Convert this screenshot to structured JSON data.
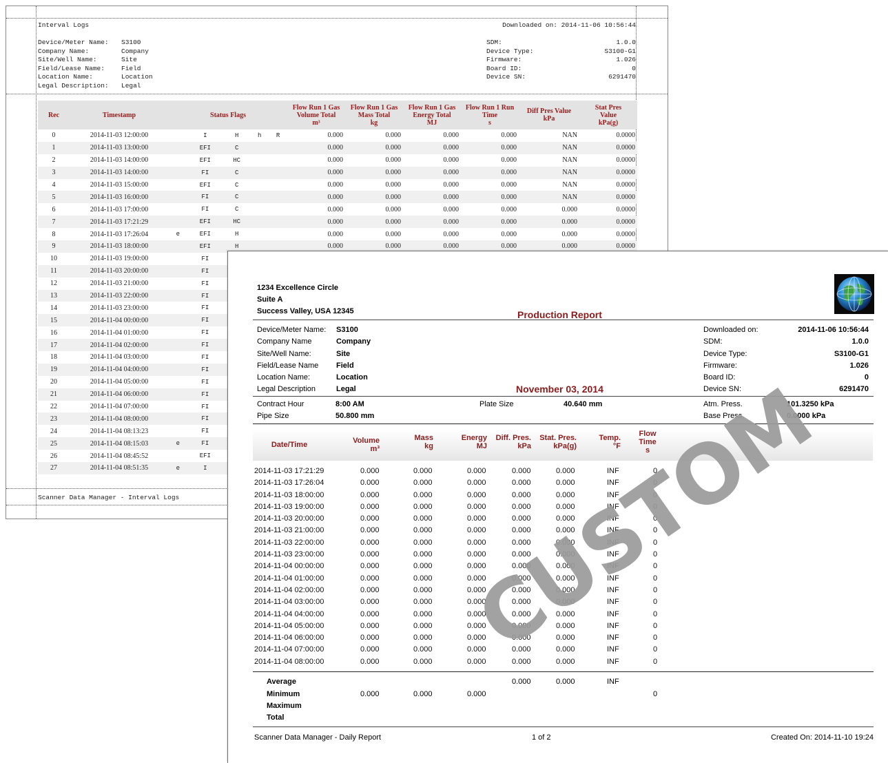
{
  "interval_logs": {
    "title": "Interval Logs",
    "downloaded": "Downloaded on: 2014-11-06 10:56:44",
    "info_left": [
      {
        "label": "Device/Meter Name:",
        "value": "S3100"
      },
      {
        "label": "Company Name:",
        "value": "Company"
      },
      {
        "label": "Site/Well Name:",
        "value": "Site"
      },
      {
        "label": "Field/Lease Name:",
        "value": "Field"
      },
      {
        "label": "Location Name:",
        "value": "Location"
      },
      {
        "label": "Legal Description:",
        "value": "Legal"
      }
    ],
    "info_right": [
      {
        "label": "SDM:",
        "value": "1.0.0"
      },
      {
        "label": "Device Type:",
        "value": "S3100-G1"
      },
      {
        "label": "Firmware:",
        "value": "1.026"
      },
      {
        "label": "Board ID:",
        "value": "0"
      },
      {
        "label": "Device SN:",
        "value": "6291470"
      }
    ],
    "headers": {
      "rec": "Rec",
      "timestamp": "Timestamp",
      "status": "Status Flags",
      "vol": [
        "Flow Run 1 Gas",
        "Volume Total",
        "m³"
      ],
      "mass": [
        "Flow Run 1 Gas",
        "Mass Total",
        "kg"
      ],
      "energy": [
        "Flow Run 1 Gas",
        "Energy Total",
        "MJ"
      ],
      "runtime": [
        "Flow Run 1 Run",
        "Time",
        "s"
      ],
      "diff": [
        "Diff Pres Value",
        "kPa"
      ],
      "stat": [
        "Stat Pres",
        "Value",
        "kPa(g)"
      ]
    },
    "rows": [
      {
        "rec": "0",
        "ts": "2014-11-03 12:00:00",
        "f0": "",
        "f1": "I",
        "f2": "H",
        "f3": "h",
        "f4": "R",
        "vol": "0.000",
        "mass": "0.000",
        "energy": "0.000",
        "time": "0.000",
        "diff": "NAN",
        "stat": "0.0000"
      },
      {
        "rec": "1",
        "ts": "2014-11-03 13:00:00",
        "f0": "",
        "f1": "EFI",
        "f2": "C",
        "f3": "",
        "f4": "",
        "vol": "0.000",
        "mass": "0.000",
        "energy": "0.000",
        "time": "0.000",
        "diff": "NAN",
        "stat": "0.0000"
      },
      {
        "rec": "2",
        "ts": "2014-11-03 14:00:00",
        "f0": "",
        "f1": "EFI",
        "f2": "HC",
        "f3": "",
        "f4": "",
        "vol": "0.000",
        "mass": "0.000",
        "energy": "0.000",
        "time": "0.000",
        "diff": "NAN",
        "stat": "0.0000"
      },
      {
        "rec": "3",
        "ts": "2014-11-03 14:00:00",
        "f0": "",
        "f1": "FI",
        "f2": "C",
        "f3": "",
        "f4": "",
        "vol": "0.000",
        "mass": "0.000",
        "energy": "0.000",
        "time": "0.000",
        "diff": "NAN",
        "stat": "0.0000"
      },
      {
        "rec": "4",
        "ts": "2014-11-03 15:00:00",
        "f0": "",
        "f1": "EFI",
        "f2": "C",
        "f3": "",
        "f4": "",
        "vol": "0.000",
        "mass": "0.000",
        "energy": "0.000",
        "time": "0.000",
        "diff": "NAN",
        "stat": "0.0000"
      },
      {
        "rec": "5",
        "ts": "2014-11-03 16:00:00",
        "f0": "",
        "f1": "FI",
        "f2": "C",
        "f3": "",
        "f4": "",
        "vol": "0.000",
        "mass": "0.000",
        "energy": "0.000",
        "time": "0.000",
        "diff": "NAN",
        "stat": "0.0000"
      },
      {
        "rec": "6",
        "ts": "2014-11-03 17:00:00",
        "f0": "",
        "f1": "FI",
        "f2": "C",
        "f3": "",
        "f4": "",
        "vol": "0.000",
        "mass": "0.000",
        "energy": "0.000",
        "time": "0.000",
        "diff": "0.000",
        "stat": "0.0000"
      },
      {
        "rec": "7",
        "ts": "2014-11-03 17:21:29",
        "f0": "",
        "f1": "EFI",
        "f2": "HC",
        "f3": "",
        "f4": "",
        "vol": "0.000",
        "mass": "0.000",
        "energy": "0.000",
        "time": "0.000",
        "diff": "0.000",
        "stat": "0.0000"
      },
      {
        "rec": "8",
        "ts": "2014-11-03 17:26:04",
        "f0": "e",
        "f1": "EFI",
        "f2": "H",
        "f3": "",
        "f4": "",
        "vol": "0.000",
        "mass": "0.000",
        "energy": "0.000",
        "time": "0.000",
        "diff": "0.000",
        "stat": "0.0000"
      },
      {
        "rec": "9",
        "ts": "2014-11-03 18:00:00",
        "f0": "",
        "f1": "EFI",
        "f2": "H",
        "f3": "",
        "f4": "",
        "vol": "0.000",
        "mass": "0.000",
        "energy": "0.000",
        "time": "0.000",
        "diff": "0.000",
        "stat": "0.0000"
      },
      {
        "rec": "10",
        "ts": "2014-11-03 19:00:00",
        "f0": "",
        "f1": "FI",
        "f2": "",
        "f3": "",
        "f4": "",
        "vol": "",
        "mass": "",
        "energy": "",
        "time": "",
        "diff": "",
        "stat": ""
      },
      {
        "rec": "11",
        "ts": "2014-11-03 20:00:00",
        "f0": "",
        "f1": "FI",
        "f2": "",
        "f3": "",
        "f4": "",
        "vol": "",
        "mass": "",
        "energy": "",
        "time": "",
        "diff": "",
        "stat": ""
      },
      {
        "rec": "12",
        "ts": "2014-11-03 21:00:00",
        "f0": "",
        "f1": "FI",
        "f2": "",
        "f3": "",
        "f4": "",
        "vol": "",
        "mass": "",
        "energy": "",
        "time": "",
        "diff": "",
        "stat": ""
      },
      {
        "rec": "13",
        "ts": "2014-11-03 22:00:00",
        "f0": "",
        "f1": "FI",
        "f2": "",
        "f3": "",
        "f4": "",
        "vol": "",
        "mass": "",
        "energy": "",
        "time": "",
        "diff": "",
        "stat": ""
      },
      {
        "rec": "14",
        "ts": "2014-11-03 23:00:00",
        "f0": "",
        "f1": "FI",
        "f2": "",
        "f3": "",
        "f4": "",
        "vol": "",
        "mass": "",
        "energy": "",
        "time": "",
        "diff": "",
        "stat": ""
      },
      {
        "rec": "15",
        "ts": "2014-11-04 00:00:00",
        "f0": "",
        "f1": "FI",
        "f2": "",
        "f3": "",
        "f4": "",
        "vol": "",
        "mass": "",
        "energy": "",
        "time": "",
        "diff": "",
        "stat": ""
      },
      {
        "rec": "16",
        "ts": "2014-11-04 01:00:00",
        "f0": "",
        "f1": "FI",
        "f2": "",
        "f3": "",
        "f4": "",
        "vol": "",
        "mass": "",
        "energy": "",
        "time": "",
        "diff": "",
        "stat": ""
      },
      {
        "rec": "17",
        "ts": "2014-11-04 02:00:00",
        "f0": "",
        "f1": "FI",
        "f2": "",
        "f3": "",
        "f4": "",
        "vol": "",
        "mass": "",
        "energy": "",
        "time": "",
        "diff": "",
        "stat": ""
      },
      {
        "rec": "18",
        "ts": "2014-11-04 03:00:00",
        "f0": "",
        "f1": "FI",
        "f2": "",
        "f3": "",
        "f4": "",
        "vol": "",
        "mass": "",
        "energy": "",
        "time": "",
        "diff": "",
        "stat": ""
      },
      {
        "rec": "19",
        "ts": "2014-11-04 04:00:00",
        "f0": "",
        "f1": "FI",
        "f2": "",
        "f3": "",
        "f4": "",
        "vol": "",
        "mass": "",
        "energy": "",
        "time": "",
        "diff": "",
        "stat": ""
      },
      {
        "rec": "20",
        "ts": "2014-11-04 05:00:00",
        "f0": "",
        "f1": "FI",
        "f2": "",
        "f3": "",
        "f4": "",
        "vol": "",
        "mass": "",
        "energy": "",
        "time": "",
        "diff": "",
        "stat": ""
      },
      {
        "rec": "21",
        "ts": "2014-11-04 06:00:00",
        "f0": "",
        "f1": "FI",
        "f2": "",
        "f3": "",
        "f4": "",
        "vol": "",
        "mass": "",
        "energy": "",
        "time": "",
        "diff": "",
        "stat": ""
      },
      {
        "rec": "22",
        "ts": "2014-11-04 07:00:00",
        "f0": "",
        "f1": "FI",
        "f2": "",
        "f3": "",
        "f4": "",
        "vol": "",
        "mass": "",
        "energy": "",
        "time": "",
        "diff": "",
        "stat": ""
      },
      {
        "rec": "23",
        "ts": "2014-11-04 08:00:00",
        "f0": "",
        "f1": "FI",
        "f2": "",
        "f3": "",
        "f4": "",
        "vol": "",
        "mass": "",
        "energy": "",
        "time": "",
        "diff": "",
        "stat": ""
      },
      {
        "rec": "24",
        "ts": "2014-11-04 08:13:23",
        "f0": "",
        "f1": "FI",
        "f2": "",
        "f3": "",
        "f4": "",
        "vol": "",
        "mass": "",
        "energy": "",
        "time": "",
        "diff": "",
        "stat": ""
      },
      {
        "rec": "25",
        "ts": "2014-11-04 08:15:03",
        "f0": "e",
        "f1": "FI",
        "f2": "",
        "f3": "",
        "f4": "",
        "vol": "",
        "mass": "",
        "energy": "",
        "time": "",
        "diff": "",
        "stat": ""
      },
      {
        "rec": "26",
        "ts": "2014-11-04 08:45:52",
        "f0": "",
        "f1": "EFI",
        "f2": "",
        "f3": "",
        "f4": "",
        "vol": "",
        "mass": "",
        "energy": "",
        "time": "",
        "diff": "",
        "stat": ""
      },
      {
        "rec": "27",
        "ts": "2014-11-04 08:51:35",
        "f0": "e",
        "f1": "I",
        "f2": "",
        "f3": "",
        "f4": "",
        "vol": "",
        "mass": "",
        "energy": "",
        "time": "",
        "diff": "",
        "stat": ""
      }
    ],
    "footer": "Scanner Data Manager - Interval Logs"
  },
  "production_report": {
    "address": [
      "1234 Excellence Circle",
      "Suite A",
      "Success Valley, USA 12345"
    ],
    "title": "Production Report",
    "logo_icon": "globe-icon",
    "date": "November 03, 2014",
    "info_left": [
      {
        "label": "Device/Meter Name:",
        "value": "S3100"
      },
      {
        "label": "Company Name",
        "value": "Company"
      },
      {
        "label": "Site/Well Name:",
        "value": "Site"
      },
      {
        "label": "Field/Lease Name",
        "value": "Field"
      },
      {
        "label": "Location Name:",
        "value": "Location"
      },
      {
        "label": "Legal Description",
        "value": "Legal"
      }
    ],
    "info_right": [
      {
        "label": "Downloaded on:",
        "value": "2014-11-06 10:56:44"
      },
      {
        "label": "SDM:",
        "value": "1.0.0"
      },
      {
        "label": "Device Type:",
        "value": "S3100-G1"
      },
      {
        "label": "Firmware:",
        "value": "1.026"
      },
      {
        "label": "Board ID:",
        "value": "0"
      },
      {
        "label": "Device SN:",
        "value": "6291470"
      }
    ],
    "params": {
      "contract_hour_label": "Contract Hour",
      "contract_hour": "8:00 AM",
      "pipe_size_label": "Pipe Size",
      "pipe_size": "50.800 mm",
      "plate_size_label": "Plate Size",
      "plate_size": "40.640 mm",
      "atm_label": "Atm. Press.",
      "atm": "101.3250 kPa",
      "base_label": "Base Press.",
      "base": "0.0000 kPa"
    },
    "headers": {
      "datetime": "Date/Time",
      "volume": [
        "Volume",
        "m³"
      ],
      "mass": [
        "Mass",
        "kg"
      ],
      "energy": [
        "Energy",
        "MJ"
      ],
      "diff": [
        "Diff. Pres.",
        "kPa"
      ],
      "stat": [
        "Stat. Pres.",
        "kPa(g)"
      ],
      "temp": [
        "Temp.",
        "°F"
      ],
      "flow": [
        "Flow",
        "Time",
        "s"
      ]
    },
    "rows": [
      [
        "2014-11-03 17:21:29",
        "0.000",
        "0.000",
        "0.000",
        "0.000",
        "0.000",
        "INF",
        "0"
      ],
      [
        "2014-11-03 17:26:04",
        "0.000",
        "0.000",
        "0.000",
        "0.000",
        "0.000",
        "INF",
        "0"
      ],
      [
        "2014-11-03 18:00:00",
        "0.000",
        "0.000",
        "0.000",
        "0.000",
        "0.000",
        "INF",
        "0"
      ],
      [
        "2014-11-03 19:00:00",
        "0.000",
        "0.000",
        "0.000",
        "0.000",
        "0.000",
        "INF",
        "0"
      ],
      [
        "2014-11-03 20:00:00",
        "0.000",
        "0.000",
        "0.000",
        "0.000",
        "0.000",
        "INF",
        "0"
      ],
      [
        "2014-11-03 21:00:00",
        "0.000",
        "0.000",
        "0.000",
        "0.000",
        "0.000",
        "INF",
        "0"
      ],
      [
        "2014-11-03 22:00:00",
        "0.000",
        "0.000",
        "0.000",
        "0.000",
        "0.000",
        "INF",
        "0"
      ],
      [
        "2014-11-03 23:00:00",
        "0.000",
        "0.000",
        "0.000",
        "0.000",
        "0.000",
        "INF",
        "0"
      ],
      [
        "2014-11-04 00:00:00",
        "0.000",
        "0.000",
        "0.000",
        "0.000",
        "0.000",
        "INF",
        "0"
      ],
      [
        "2014-11-04 01:00:00",
        "0.000",
        "0.000",
        "0.000",
        "0.000",
        "0.000",
        "INF",
        "0"
      ],
      [
        "2014-11-04 02:00:00",
        "0.000",
        "0.000",
        "0.000",
        "0.000",
        "0.000",
        "INF",
        "0"
      ],
      [
        "2014-11-04 03:00:00",
        "0.000",
        "0.000",
        "0.000",
        "0.000",
        "0.000",
        "INF",
        "0"
      ],
      [
        "2014-11-04 04:00:00",
        "0.000",
        "0.000",
        "0.000",
        "0.000",
        "0.000",
        "INF",
        "0"
      ],
      [
        "2014-11-04 05:00:00",
        "0.000",
        "0.000",
        "0.000",
        "0.000",
        "0.000",
        "INF",
        "0"
      ],
      [
        "2014-11-04 06:00:00",
        "0.000",
        "0.000",
        "0.000",
        "0.000",
        "0.000",
        "INF",
        "0"
      ],
      [
        "2014-11-04 07:00:00",
        "0.000",
        "0.000",
        "0.000",
        "0.000",
        "0.000",
        "INF",
        "0"
      ],
      [
        "2014-11-04 08:00:00",
        "0.000",
        "0.000",
        "0.000",
        "0.000",
        "0.000",
        "INF",
        "0"
      ]
    ],
    "summary": {
      "average_label": "Average",
      "minimum_label": "Minimum",
      "maximum_label": "Maximum",
      "total_label": "Total",
      "avg_diff": "0.000",
      "avg_stat": "0.000",
      "avg_temp": "INF",
      "min_volume": "0.000",
      "min_mass": "0.000",
      "min_energy": "0.000",
      "min_flow": "0"
    },
    "footer_left": "Scanner Data Manager - Daily Report",
    "footer_center": "1 of 2",
    "footer_right": "Created On: 2014-11-10 19:24",
    "watermark": "CUSTOM"
  }
}
